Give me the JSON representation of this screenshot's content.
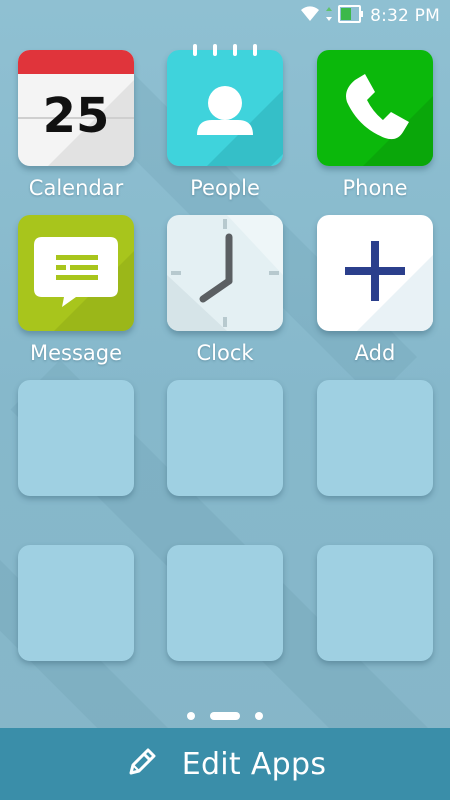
{
  "status_bar": {
    "time": "8:32 PM",
    "icons": [
      "wifi-icon",
      "signal-arrows-icon",
      "battery-icon"
    ]
  },
  "apps": [
    {
      "label": "Calendar",
      "icon": "calendar-icon",
      "date": "25",
      "colors": {
        "top": "#e0343b",
        "body": "#f4f4f4"
      }
    },
    {
      "label": "People",
      "icon": "person-icon",
      "colors": {
        "body": "#3fd3dc"
      }
    },
    {
      "label": "Phone",
      "icon": "phone-handset-icon",
      "colors": {
        "body": "#0bb80b"
      }
    },
    {
      "label": "Message",
      "icon": "speech-bubble-icon",
      "colors": {
        "body": "#a8c51c"
      }
    },
    {
      "label": "Clock",
      "icon": "clock-icon",
      "colors": {
        "body": "#e4f0f3"
      }
    },
    {
      "label": "Add",
      "icon": "plus-icon",
      "colors": {
        "body": "#ffffff",
        "accent": "#2b3f8c"
      }
    }
  ],
  "empty_slot_color": "#9fd0e2",
  "page_indicator": {
    "pages": 3,
    "current": 2
  },
  "bottom_bar": {
    "label": "Edit Apps",
    "icon": "pencil-icon",
    "color": "#3a8ea9"
  }
}
